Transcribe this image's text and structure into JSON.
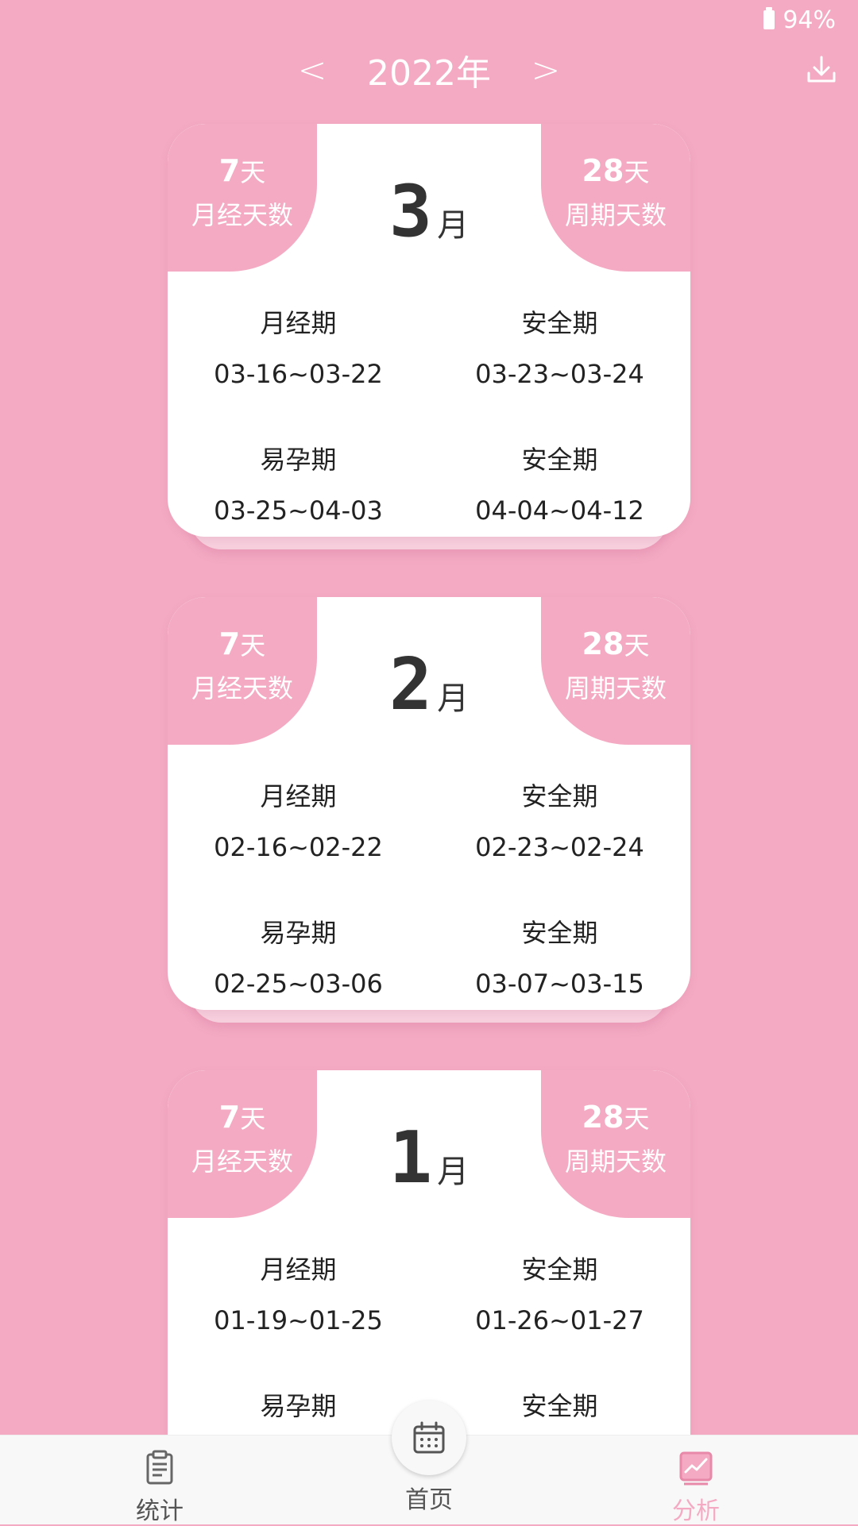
{
  "status": {
    "battery": "94%"
  },
  "header": {
    "prev": "<",
    "year": "2022年",
    "next": ">",
    "download_icon": "download-icon"
  },
  "cards": [
    {
      "month": "3",
      "month_unit": "月",
      "period_days": "7",
      "period_unit": "天",
      "period_caption": "月经天数",
      "cycle_days": "28",
      "cycle_unit": "天",
      "cycle_caption": "周期天数",
      "phases": [
        {
          "label": "月经期",
          "range": "03-16~03-22"
        },
        {
          "label": "安全期",
          "range": "03-23~03-24"
        },
        {
          "label": "易孕期",
          "range": "03-25~04-03"
        },
        {
          "label": "安全期",
          "range": "04-04~04-12"
        }
      ]
    },
    {
      "month": "2",
      "month_unit": "月",
      "period_days": "7",
      "period_unit": "天",
      "period_caption": "月经天数",
      "cycle_days": "28",
      "cycle_unit": "天",
      "cycle_caption": "周期天数",
      "phases": [
        {
          "label": "月经期",
          "range": "02-16~02-22"
        },
        {
          "label": "安全期",
          "range": "02-23~02-24"
        },
        {
          "label": "易孕期",
          "range": "02-25~03-06"
        },
        {
          "label": "安全期",
          "range": "03-07~03-15"
        }
      ]
    },
    {
      "month": "1",
      "month_unit": "月",
      "period_days": "7",
      "period_unit": "天",
      "period_caption": "月经天数",
      "cycle_days": "28",
      "cycle_unit": "天",
      "cycle_caption": "周期天数",
      "phases": [
        {
          "label": "月经期",
          "range": "01-19~01-25"
        },
        {
          "label": "安全期",
          "range": "01-26~01-27"
        },
        {
          "label": "易孕期",
          "range": ""
        },
        {
          "label": "安全期",
          "range": ""
        }
      ]
    }
  ],
  "nav": {
    "stats": "统计",
    "home": "首页",
    "analysis": "分析"
  },
  "colors": {
    "accent": "#f4aac3",
    "background": "#f4aac3",
    "text": "#222222"
  }
}
